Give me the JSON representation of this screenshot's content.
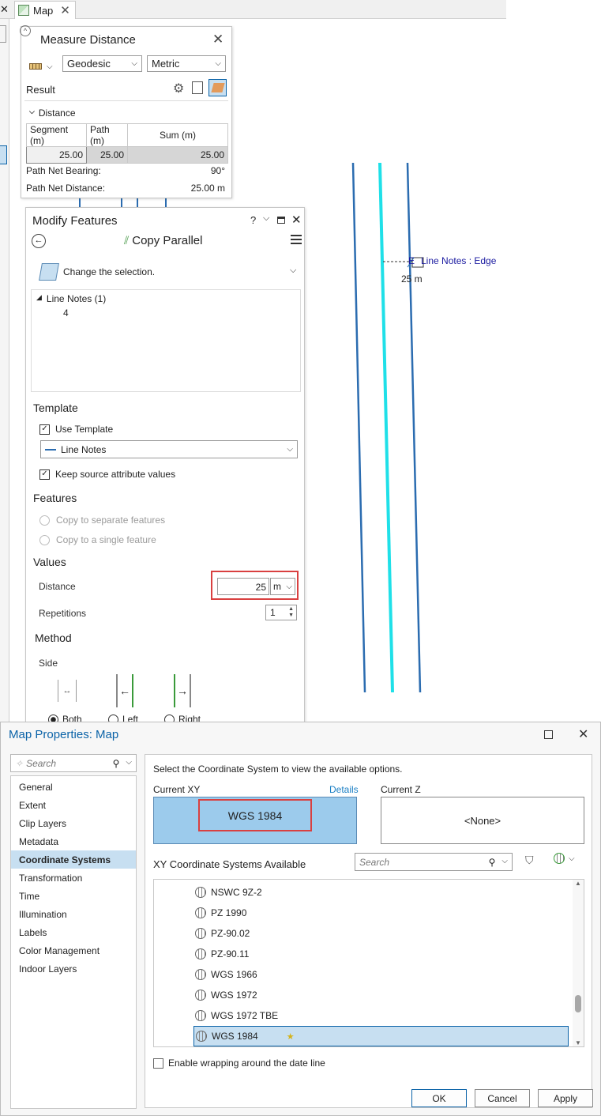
{
  "tab": {
    "title": "Map"
  },
  "measure": {
    "title": "Measure Distance",
    "mode": "Geodesic",
    "units": "Metric",
    "result_label": "Result",
    "distance_label": "Distance",
    "headers": [
      "Segment (m)",
      "Path (m)",
      "Sum (m)"
    ],
    "values": [
      "25.00",
      "25.00",
      "25.00"
    ],
    "bearing_label": "Path Net Bearing:",
    "bearing_value": "90°",
    "distance_net_label": "Path Net Distance:",
    "distance_net_value": "25.00 m"
  },
  "modify": {
    "title": "Modify Features",
    "help": "?",
    "tool": "Copy Parallel",
    "change_selection": "Change the selection.",
    "tree_group": "Line Notes (1)",
    "tree_item": "4",
    "template_section": "Template",
    "use_template": "Use Template",
    "template_value": "Line Notes",
    "keep_source": "Keep source attribute values",
    "features_section": "Features",
    "copy_separate": "Copy to separate features",
    "copy_single": "Copy to a single feature",
    "values_section": "Values",
    "distance_label": "Distance",
    "distance_value": "25",
    "distance_unit": "m",
    "repetitions_label": "Repetitions",
    "repetitions_value": "1",
    "method_section": "Method",
    "side_label": "Side",
    "side_both": "Both",
    "side_left": "Left",
    "side_right": "Right"
  },
  "map": {
    "snap_label": "Line Notes : Edge",
    "snap_partial": "E",
    "distance_tip": "25 m"
  },
  "dialog": {
    "title": "Map Properties: Map",
    "search_placeholder": "Search",
    "nav": [
      "General",
      "Extent",
      "Clip Layers",
      "Metadata",
      "Coordinate Systems",
      "Transformation",
      "Time",
      "Illumination",
      "Labels",
      "Color Management",
      "Indoor Layers"
    ],
    "nav_selected": 4,
    "instruction": "Select the Coordinate System to view the available options.",
    "current_xy_label": "Current XY",
    "details_link": "Details",
    "current_xy_value": "WGS 1984",
    "current_z_label": "Current Z",
    "current_z_value": "<None>",
    "available_label": "XY Coordinate Systems Available",
    "available_search_placeholder": "Search",
    "cs_list": [
      "NSWC 9Z-2",
      "PZ 1990",
      "PZ-90.02",
      "PZ-90.11",
      "WGS 1966",
      "WGS 1972",
      "WGS 1972 TBE",
      "WGS 1984"
    ],
    "cs_selected": 7,
    "wrap_label": "Enable wrapping around the date line",
    "ok": "OK",
    "cancel": "Cancel",
    "apply": "Apply"
  },
  "colors": {
    "accent": "#0b63a8",
    "selection": "#c7dff1",
    "current_xy_bg": "#9ccbec",
    "highlight_red": "#d94040",
    "line_blue": "#2b6cb0",
    "line_cyan": "#1fe0e8"
  }
}
